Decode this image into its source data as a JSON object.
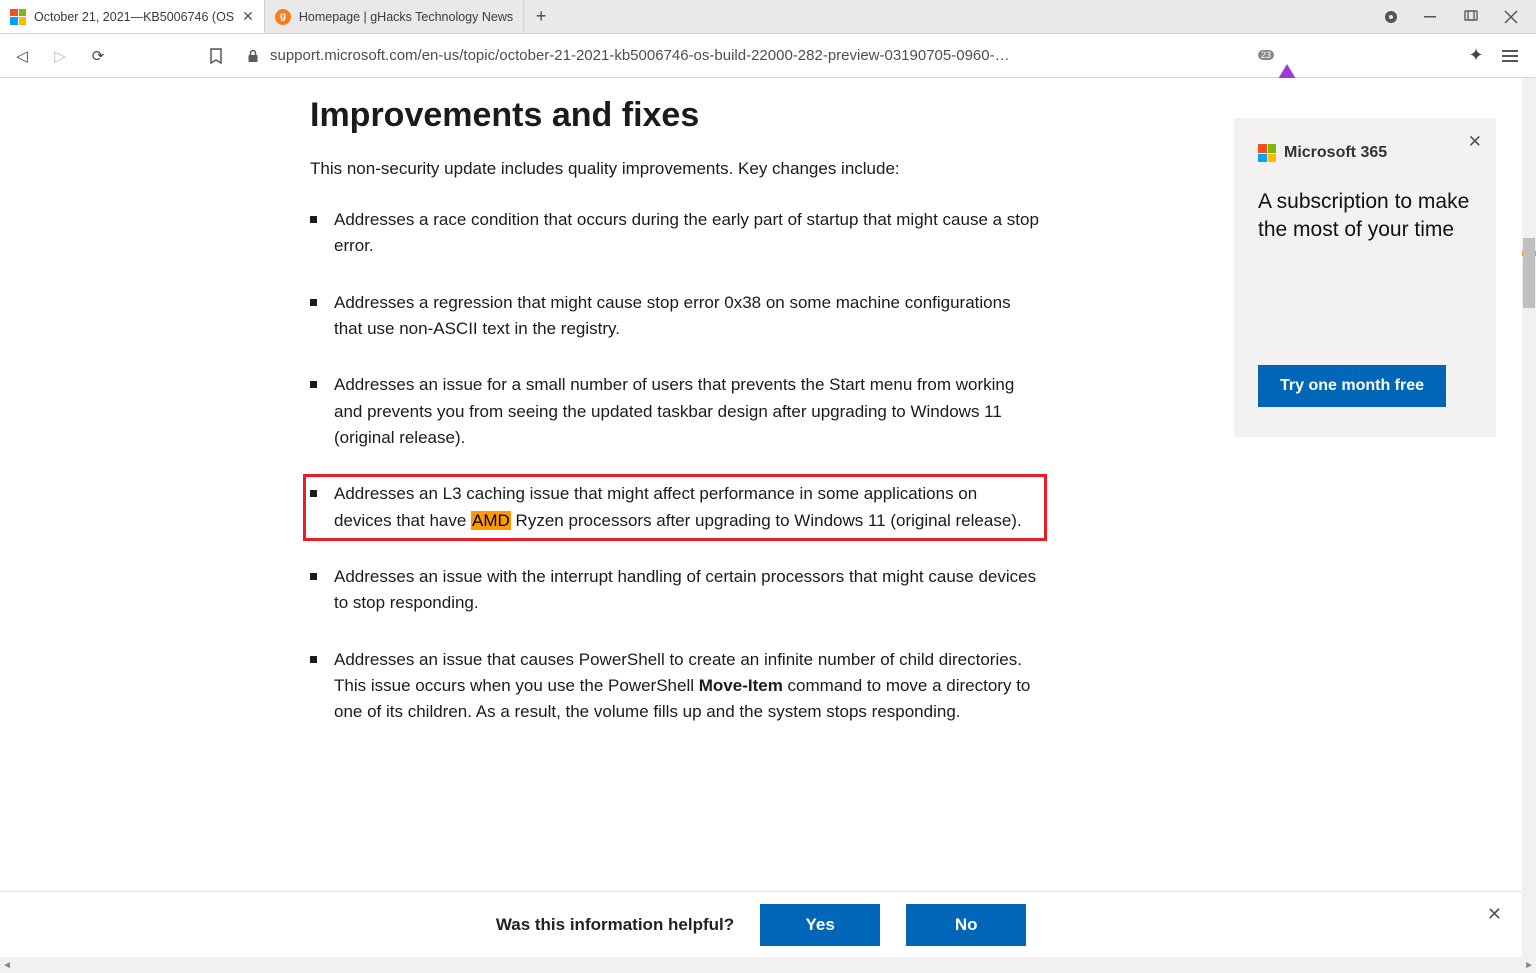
{
  "tabs": [
    {
      "title": "October 21, 2021—KB5006746 (OS",
      "active": true
    },
    {
      "title": "Homepage | gHacks Technology News",
      "active": false
    }
  ],
  "url": "support.microsoft.com/en-us/topic/october-21-2021-kb5006746-os-build-22000-282-preview-03190705-0960-…",
  "brave_badge": "23",
  "article": {
    "heading": "Improvements and fixes",
    "intro": "This non-security update includes quality improvements. Key changes include:",
    "items": {
      "0": "Addresses a race condition that occurs during the early part of startup that might cause a stop error.",
      "1": "Addresses a regression that might cause stop error 0x38 on some machine configurations that use non-ASCII text in the registry.",
      "2": "Addresses an issue for a small number of users that prevents the Start menu from working and prevents you from seeing the updated taskbar design after upgrading to Windows 11 (original release).",
      "3a": "Addresses an L3 caching issue that might affect performance in some applications on devices that have ",
      "3hl": "AMD",
      "3b": " Ryzen processors after upgrading to Windows 11 (original release).",
      "4": "Addresses an issue with the interrupt handling of certain processors that might cause devices to stop responding.",
      "5a": "Addresses an issue that causes PowerShell to create an infinite number of child directories. This issue occurs when you use the PowerShell ",
      "5bold": "Move-Item",
      "5b": " command to move a directory to one of its children. As a result, the volume fills up and the system stops responding."
    }
  },
  "card": {
    "brand": "Microsoft 365",
    "text": "A subscription to make the most of your time",
    "cta": "Try one month free"
  },
  "feedback": {
    "question": "Was this information helpful?",
    "yes": "Yes",
    "no": "No"
  }
}
